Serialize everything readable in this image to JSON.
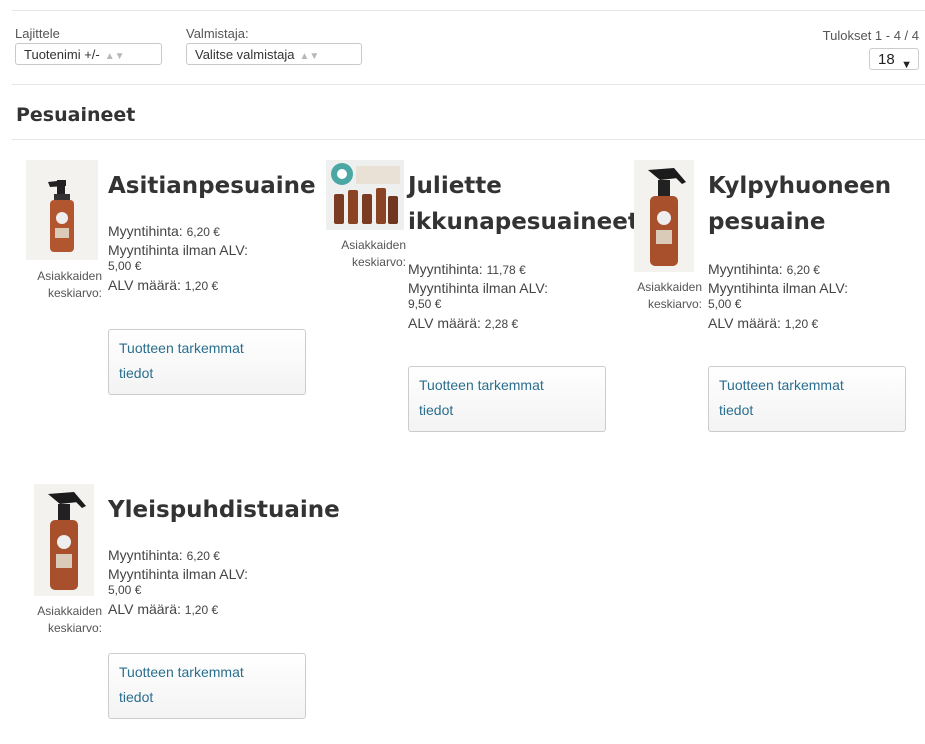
{
  "toolbar": {
    "sort_label": "Lajittele",
    "sort_value": "Tuotenimi +/-",
    "manufacturer_label": "Valmistaja:",
    "manufacturer_value": "Valitse valmistaja",
    "results_text": "Tulokset 1 - 4 / 4",
    "limit_value": "18"
  },
  "category": {
    "title": "Pesuaineet"
  },
  "products": [
    {
      "name": "Asitianpesuaine",
      "rating_label_1": "Asiakkaiden",
      "rating_label_2": "keskiarvo:",
      "price_label": "Myyntihinta:",
      "price_value": "6,20 €",
      "net_label": "Myyntihinta ilman ALV:",
      "net_value": "5,00 €",
      "vat_label": "ALV määrä:",
      "vat_value": "1,20 €",
      "button_line1": "Tuotteen tarkemmat",
      "button_line2": "tiedot",
      "image_icon": "spray-bottle-image"
    },
    {
      "name_line1": "Juliette",
      "name_line2": "ikkunapesuaineet",
      "rating_label_1": "Asiakkaiden",
      "rating_label_2": "keskiarvo:",
      "price_label": "Myyntihinta:",
      "price_value": "11,78 €",
      "net_label": "Myyntihinta ilman ALV:",
      "net_value": "9,50 €",
      "vat_label": "ALV määrä:",
      "vat_value": "2,28 €",
      "button_line1": "Tuotteen tarkemmat",
      "button_line2": "tiedot",
      "image_icon": "product-set-image"
    },
    {
      "name_line1": "Kylpyhuoneen",
      "name_line2": "pesuaine",
      "rating_label_1": "Asiakkaiden",
      "rating_label_2": "keskiarvo:",
      "price_label": "Myyntihinta:",
      "price_value": "6,20 €",
      "net_label": "Myyntihinta ilman ALV:",
      "net_value": "5,00 €",
      "vat_label": "ALV määrä:",
      "vat_value": "1,20 €",
      "button_line1": "Tuotteen tarkemmat",
      "button_line2": "tiedot",
      "image_icon": "spray-bottle-image"
    },
    {
      "name": "Yleispuhdistuaine",
      "rating_label_1": "Asiakkaiden",
      "rating_label_2": "keskiarvo:",
      "price_label": "Myyntihinta:",
      "price_value": "6,20 €",
      "net_label": "Myyntihinta ilman ALV:",
      "net_value": "5,00 €",
      "vat_label": "ALV määrä:",
      "vat_value": "1,20 €",
      "button_line1": "Tuotteen tarkemmat",
      "button_line2": "tiedot",
      "image_icon": "spray-bottle-image"
    }
  ],
  "colors": {
    "link": "#2a6e8e",
    "text": "#333333"
  }
}
